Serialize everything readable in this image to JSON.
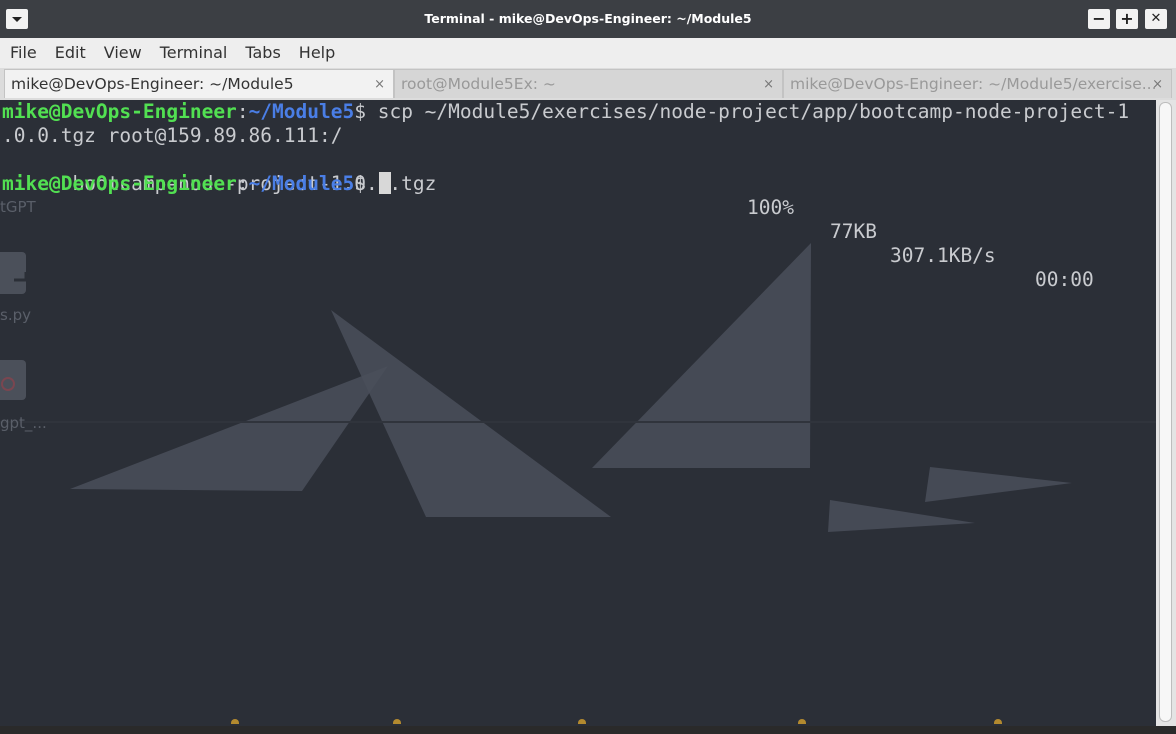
{
  "window": {
    "title": "Terminal - mike@DevOps-Engineer: ~/Module5",
    "menu_icon": "chevron-down-icon",
    "minimize_label": "−",
    "maximize_label": "+",
    "close_label": "✕"
  },
  "menu": {
    "items": [
      "File",
      "Edit",
      "View",
      "Terminal",
      "Tabs",
      "Help"
    ]
  },
  "tabs": [
    {
      "label": "mike@DevOps-Engineer: ~/Module5",
      "active": true,
      "close": "×"
    },
    {
      "label": "root@Module5Ex: ~",
      "active": false,
      "close": "×"
    },
    {
      "label": "mike@DevOps-Engineer: ~/Module5/exercise...",
      "active": false,
      "close": "×"
    }
  ],
  "terminal": {
    "prompt_user": "mike@DevOps-Engineer",
    "prompt_sep": ":",
    "prompt_path": "~/Module5",
    "prompt_sym": "$",
    "command_line1": " scp ~/Module5/exercises/node-project/app/bootcamp-node-project-1",
    "command_line2": ".0.0.tgz root@159.89.86.111:/",
    "output_file": "bootcamp-node-project-1.0.0.tgz",
    "output_percent": "100%",
    "output_size": "77KB",
    "output_rate": "307.1KB/s",
    "output_time": "00:00"
  },
  "desktop_ghosts": {
    "item1": "tGPT",
    "item2": "s.py",
    "item3": "gpt_..."
  },
  "colors": {
    "terminal_bg": "#2b2f37",
    "prompt_user": "#52e052",
    "prompt_path": "#4a7ee6",
    "text": "#c9cbcf"
  }
}
